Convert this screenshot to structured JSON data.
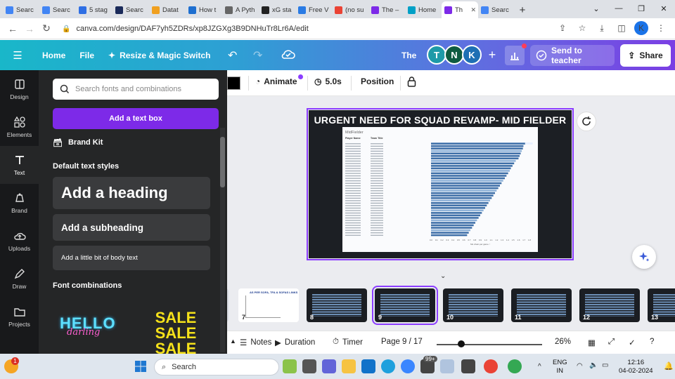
{
  "browser": {
    "tabs": [
      {
        "label": "Searc",
        "color": "#4285f4"
      },
      {
        "label": "Searc",
        "color": "#4285f4"
      },
      {
        "label": "5 stag",
        "color": "#2f6fe4"
      },
      {
        "label": "Searc",
        "color": "#1a2a5a"
      },
      {
        "label": "Datat",
        "color": "#f0a020"
      },
      {
        "label": "How t",
        "color": "#1e6fd0"
      },
      {
        "label": "A Pyth",
        "color": "#666666"
      },
      {
        "label": "xG sta",
        "color": "#222222"
      },
      {
        "label": "Free V",
        "color": "#2a7be4"
      },
      {
        "label": "(no su",
        "color": "#ea4335"
      },
      {
        "label": "The –",
        "color": "#7d2ae8"
      },
      {
        "label": "Home",
        "color": "#00a0c6"
      },
      {
        "label": "Th",
        "color": "#7d2ae8"
      },
      {
        "label": "Searc",
        "color": "#4285f4"
      }
    ],
    "url": "canva.com/design/DAF7yh5ZDRs/xp8JZGXg3B9DNHuTr8Lr6A/edit",
    "profile_initial": "K"
  },
  "header": {
    "home": "Home",
    "file": "File",
    "resize": "Resize & Magic Switch",
    "title": "The",
    "avatars": [
      {
        "initial": "T",
        "color": "#1e9aa8"
      },
      {
        "initial": "N",
        "color": "#0f5b40"
      },
      {
        "initial": "K",
        "color": "#1e6fb4"
      }
    ],
    "send_to_teacher": "Send to teacher",
    "share": "Share"
  },
  "rail": [
    {
      "label": "Design",
      "icon": "layout-icon"
    },
    {
      "label": "Elements",
      "icon": "shapes-icon"
    },
    {
      "label": "Text",
      "icon": "text-icon"
    },
    {
      "label": "Brand",
      "icon": "brand-icon"
    },
    {
      "label": "Uploads",
      "icon": "cloud-upload-icon"
    },
    {
      "label": "Draw",
      "icon": "pen-icon"
    },
    {
      "label": "Projects",
      "icon": "folder-icon"
    }
  ],
  "panel": {
    "search_placeholder": "Search fonts and combinations",
    "add_text_box": "Add a text box",
    "brand_kit": "Brand Kit",
    "default_styles_label": "Default text styles",
    "heading": "Add a heading",
    "subheading": "Add a subheading",
    "body": "Add a little bit of body text",
    "font_combinations_label": "Font combinations",
    "combo1": [
      "HELLO",
      "darling"
    ],
    "combo2": [
      "SALE",
      "SALE",
      "SALE"
    ]
  },
  "toolbar": {
    "animate": "Animate",
    "duration": "5.0s",
    "position": "Position"
  },
  "slide": {
    "title": "URGENT NEED FOR SQUAD REVAMP- MID FIELDER",
    "chart_subtitle": "MidFielder",
    "col_player": "Player Name",
    "col_team": "Team Title",
    "x_caption": "SG chain per game ↑"
  },
  "chart_data": {
    "type": "bar",
    "orientation": "horizontal",
    "title": "MidFielder",
    "xlabel": "SG chain per game",
    "xlim": [
      0,
      1.8
    ],
    "x_ticks": [
      "0.0",
      "0.1",
      "0.2",
      "0.3",
      "0.4",
      "0.5",
      "0.6",
      "0.7",
      "0.8",
      "0.9",
      "1.0",
      "1.1",
      "1.2",
      "1.3",
      "1.4",
      "1.5",
      "1.6",
      "1.7",
      "1.8"
    ],
    "values": [
      1.72,
      1.69,
      1.68,
      1.66,
      1.64,
      1.62,
      1.6,
      1.55,
      1.52,
      1.49,
      1.46,
      1.44,
      1.41,
      1.38,
      1.35,
      1.32,
      1.29,
      1.26,
      1.23,
      1.2,
      1.17,
      1.14,
      1.11,
      1.08,
      1.05,
      1.02,
      0.99,
      0.96,
      0.93,
      0.9,
      0.87,
      0.84,
      0.81,
      0.78,
      0.75,
      0.72,
      0.69,
      0.66
    ],
    "highlight_color": "#e8f0ff",
    "bar_color": "#3e6fa8"
  },
  "pages": {
    "thumbs": [
      "7",
      "8",
      "9",
      "10",
      "11",
      "12",
      "13"
    ],
    "selected": "9",
    "thumb7_title": "AS PER SOFA, TFA & SOFAS LINKS"
  },
  "bottom": {
    "notes": "Notes",
    "duration": "Duration",
    "timer": "Timer",
    "page": "Page 9 / 17",
    "zoom": "26%"
  },
  "taskbar": {
    "search": "Search",
    "lang_top": "ENG",
    "lang_bottom": "IN",
    "time": "12:16",
    "date": "04-02-2024",
    "badge": "99+",
    "notif": "1"
  }
}
